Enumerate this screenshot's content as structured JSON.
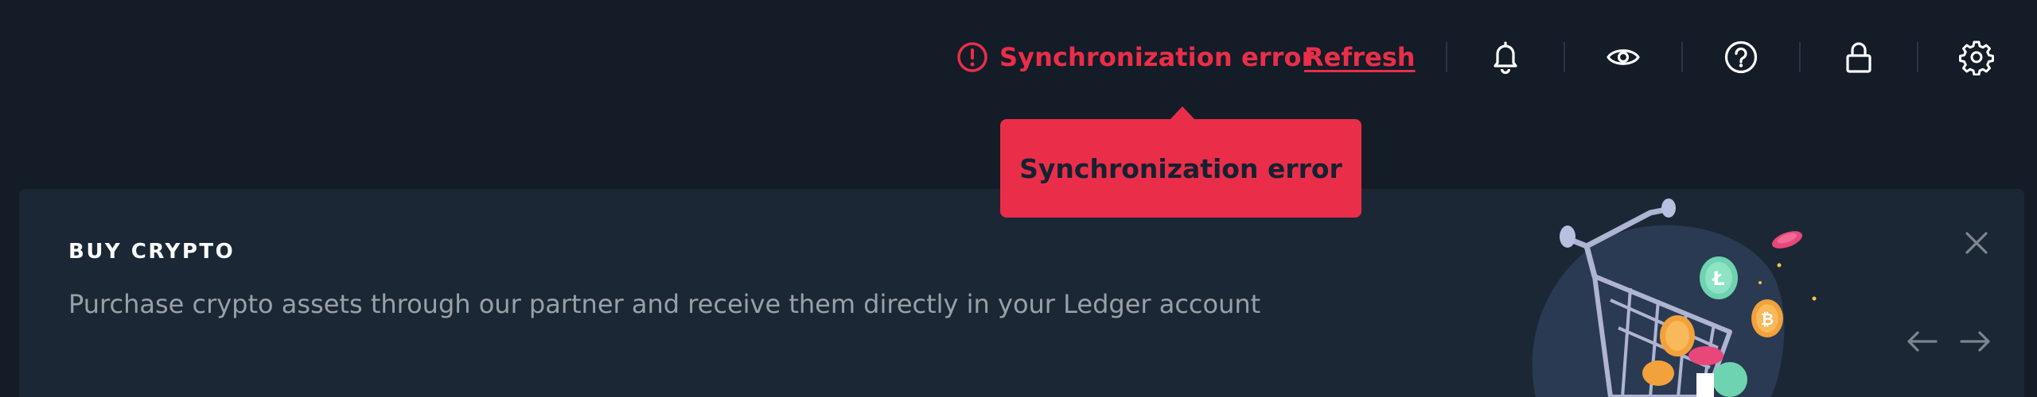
{
  "header": {
    "sync_status": "Synchronization error",
    "refresh_label": "Refresh",
    "icons": [
      "error-icon",
      "bell-icon",
      "eye-icon",
      "help-icon",
      "lock-icon",
      "settings-icon"
    ]
  },
  "tooltip": {
    "text": "Synchronization error"
  },
  "banner": {
    "title": "BUY CRYPTO",
    "description": "Purchase crypto assets through our partner and receive them directly in your Ledger account"
  },
  "colors": {
    "background": "#131c27",
    "banner_background": "#1b2735",
    "error": "#ea2e49",
    "icon": "#ffffff",
    "muted_text": "#9aa0a7"
  }
}
